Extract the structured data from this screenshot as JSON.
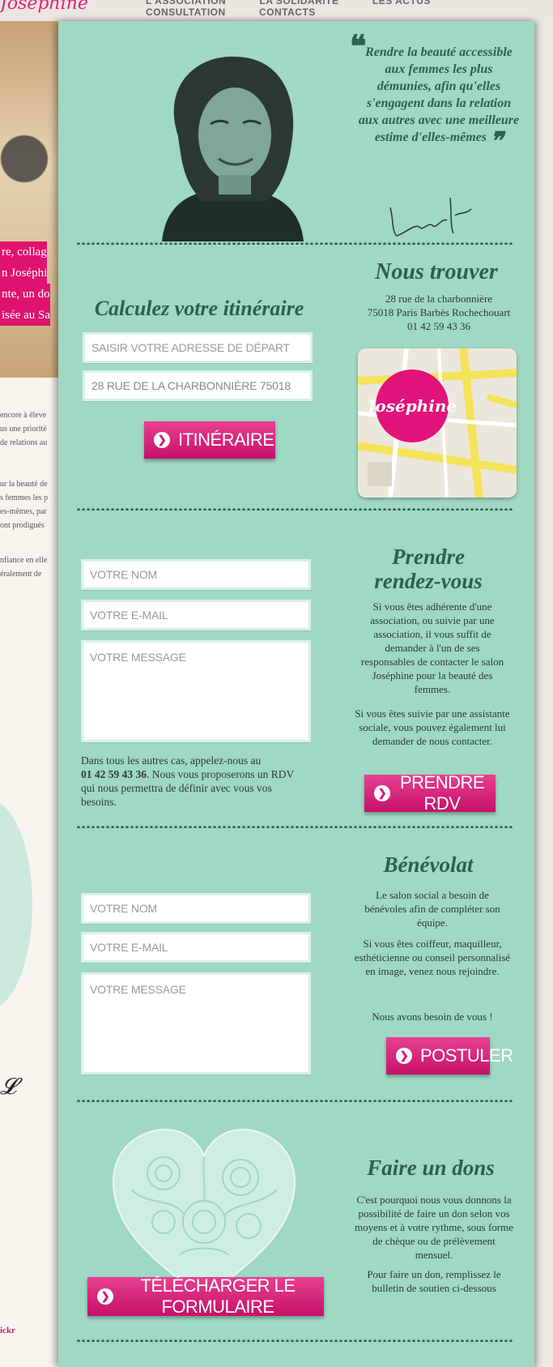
{
  "nav": {
    "logo": "Joséphine",
    "items": [
      "L'association",
      "La solidarité",
      "Les actus",
      "Consultation",
      "Contacts"
    ]
  },
  "left_column": {
    "pink_lines": [
      "re, collag",
      "n Joséphi",
      "nte, un do",
      "isée au Sa"
    ],
    "text_lines": [
      "encore à éleve",
      "us une priorité",
      "de relations au",
      "",
      "ur la beauté de",
      "s femmes les p",
      "es-mêmes, par",
      "ont prodigués",
      "",
      "nfiance en elle",
      "éralement de"
    ],
    "social": "ickr"
  },
  "quote": {
    "text": "Rendre la beauté accessible aux femmes les plus démunies, afin qu'elles s'engagent dans la relation aux autres avec une meilleure estime d'elles-mêmes",
    "open_mark": "❝",
    "close_mark": "❞"
  },
  "itinerary": {
    "title": "Calculez votre itinéraire",
    "start_placeholder": "SAISIR VOTRE ADRESSE DE DÉPART",
    "destination_value": "28 RUE DE LA CHARBONNIÈRE 75018",
    "button": "ITINÉRAIRE"
  },
  "find_us": {
    "title": "Nous trouver",
    "address_line1": "28 rue de la charbonnière",
    "address_line2": "75018 Paris Barbès Rochechouart",
    "phone": "01 42 59 43 36",
    "map_logo": "Joséphine"
  },
  "rdv_form": {
    "name_placeholder": "VOTRE NOM",
    "email_placeholder": "VOTRE E-MAIL",
    "message_placeholder": "VOTRE MESSAGE",
    "note_before": "Dans tous les autres cas, appelez-nous au",
    "note_phone": "01 42 59 43 36",
    "note_after": ". Nous vous proposerons un RDV qui nous permettra de définir avec vous vos besoins."
  },
  "rdv": {
    "title_line1": "Prendre",
    "title_line2": "rendez-vous",
    "para1": "Si vous êtes adhérente d'une association, ou suivie par une association, il vous suffit de demander à l'un de ses responsables de contacter le salon Joséphine pour la beauté des femmes.",
    "para2": "Si vous êtes suivie par une assistante sociale, vous pouvez également lui demander de nous contacter.",
    "button": "PRENDRE RDV"
  },
  "volunteer_form": {
    "name_placeholder": "VOTRE NOM",
    "email_placeholder": "VOTRE E-MAIL",
    "message_placeholder": "VOTRE MESSAGE"
  },
  "volunteer": {
    "title": "Bénévolat",
    "para1": "Le salon social a besoin de bénévoles afin de compléter son équipe.",
    "para2": "Si vous êtes coiffeur, maquilleur, esthéticienne ou conseil personnalisé en image, venez nous rejoindre.",
    "para3": "Nous avons besoin de vous !",
    "button": "POSTULER"
  },
  "donation": {
    "title": "Faire un dons",
    "para1": "C'est pourquoi nous vous donnons la possibilité de faire un don selon vos moyens et à votre rythme, sous forme de chèque ou de prélèvement mensuel.",
    "para2": "Pour faire un don, remplissez le bulletin de soutien ci-dessous",
    "button": "TÉLÉCHARGER LE FORMULAIRE"
  },
  "colors": {
    "panel": "#9fd8c3",
    "heading": "#2f5e4c",
    "accent": "#d3187a"
  }
}
